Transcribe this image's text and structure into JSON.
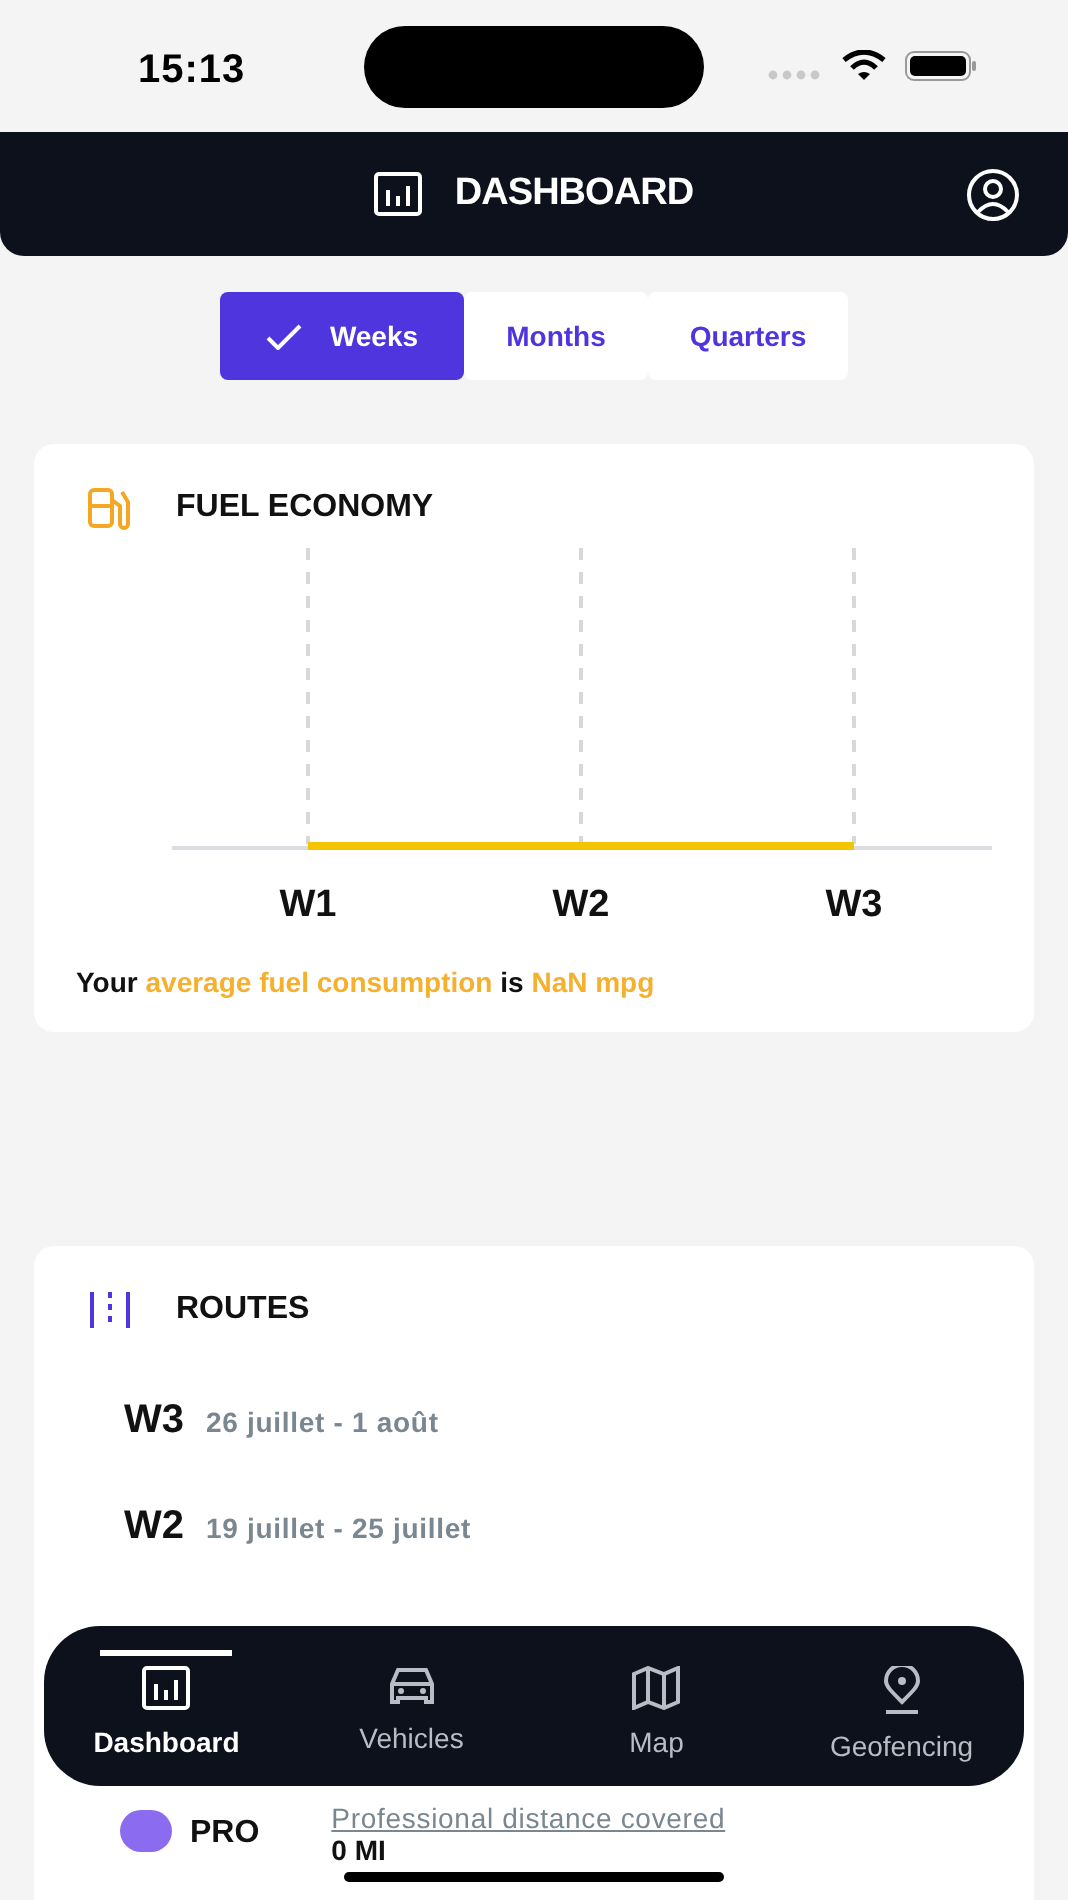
{
  "status_bar": {
    "time": "15:13"
  },
  "header": {
    "title": "DASHBOARD"
  },
  "period_tabs": [
    {
      "label": "Weeks",
      "selected": true
    },
    {
      "label": "Months",
      "selected": false
    },
    {
      "label": "Quarters",
      "selected": false
    }
  ],
  "fuel_card": {
    "title": "FUEL ECONOMY",
    "axis_labels": [
      "W1",
      "W2",
      "W3"
    ],
    "summary": [
      {
        "text": "Your ",
        "highlight": false
      },
      {
        "text": "average fuel consumption",
        "highlight": true
      },
      {
        "text": " is ",
        "highlight": false
      },
      {
        "text": "NaN mpg",
        "highlight": true
      }
    ]
  },
  "routes_card": {
    "title": "ROUTES",
    "weeks": [
      {
        "week": "W3",
        "dates": "26 juillet - 1 août"
      },
      {
        "week": "W2",
        "dates": "19 juillet - 25 juillet"
      }
    ],
    "legend": [
      {
        "label": "PRO",
        "color": "#8b6cf0",
        "description": "Professional distance covered",
        "value": "0 MI"
      }
    ]
  },
  "tab_bar": [
    {
      "label": "Dashboard",
      "selected": true,
      "kind": "dashboard"
    },
    {
      "label": "Vehicles",
      "selected": false,
      "kind": "vehicles"
    },
    {
      "label": "Map",
      "selected": false,
      "kind": "map"
    },
    {
      "label": "Geofencing",
      "selected": false,
      "kind": "geofencing"
    }
  ]
}
